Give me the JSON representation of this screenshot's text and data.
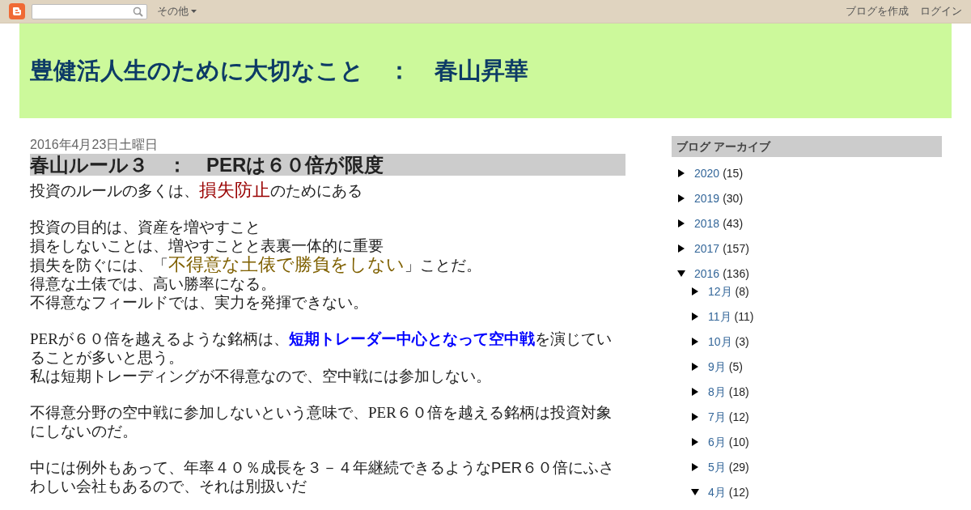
{
  "navbar": {
    "more_menu": "その他",
    "links": [
      "ブログを作成",
      "ログイン"
    ]
  },
  "header": {
    "title": "豊健活人生のために大切なこと　：　春山昇華"
  },
  "post": {
    "date": "2016年4月23日土曜日",
    "title": "春山ルール３　：　PERは６０倍が限度",
    "paragraphs": [
      {
        "kind": "sans",
        "lines": [
          [
            {
              "kind": "plain",
              "text": "投資のルールの多くは、"
            },
            {
              "kind": "red",
              "text": "損失防止"
            },
            {
              "kind": "plain",
              "text": "のためにある"
            }
          ]
        ]
      },
      {
        "kind": "sans",
        "lines": [
          [
            {
              "kind": "plain",
              "text": "投資の目的は、資産を増やすこと"
            }
          ],
          [
            {
              "kind": "plain",
              "text": "損をしないことは、増やすことと表裏一体的に重要"
            }
          ],
          [
            {
              "kind": "plain",
              "text": "損失を防ぐには、「"
            },
            {
              "kind": "olive",
              "text": "不得意な土俵で勝負をしない"
            },
            {
              "kind": "plain",
              "text": "」ことだ。"
            }
          ],
          [
            {
              "kind": "plain",
              "text": "得意な土俵では、高い勝率になる。"
            }
          ],
          [
            {
              "kind": "plain",
              "text": "不得意なフィールドでは、実力を発揮できない。"
            }
          ]
        ]
      },
      {
        "kind": "serif",
        "lines": [
          [
            {
              "kind": "plain",
              "text": "PERが６０倍を越えるような銘柄は、"
            },
            {
              "kind": "link",
              "text": "短期トレーダー中心となって空中戦"
            },
            {
              "kind": "plain",
              "text": "を演じていることが多いと思う。"
            }
          ],
          [
            {
              "kind": "plain",
              "text": "私は短期トレーディングが不得意なので、空中戦には参加しない。"
            }
          ]
        ]
      },
      {
        "kind": "serif",
        "lines": [
          [
            {
              "kind": "plain",
              "text": "不得意分野の空中戦に参加しないという意味で、PER６０倍を越える銘柄は投資対象にしないのだ。"
            }
          ]
        ]
      },
      {
        "kind": "sans",
        "lines": [
          [
            {
              "kind": "plain",
              "text": "中には例外もあって、年率４０％成長を３－４年継続できるようなPER６０倍にふさわしい会社もあるので、それは別扱いだ"
            }
          ]
        ]
      }
    ]
  },
  "sidebar": {
    "title": "ブログ アーカイブ",
    "archive": [
      {
        "label": "2020",
        "count": "(15)",
        "expanded": false
      },
      {
        "label": "2019",
        "count": "(30)",
        "expanded": false
      },
      {
        "label": "2018",
        "count": "(43)",
        "expanded": false
      },
      {
        "label": "2017",
        "count": "(157)",
        "expanded": false
      },
      {
        "label": "2016",
        "count": "(136)",
        "expanded": true,
        "children": [
          {
            "label": "12月",
            "count": "(8)",
            "expanded": false
          },
          {
            "label": "11月",
            "count": "(11)",
            "expanded": false
          },
          {
            "label": "10月",
            "count": "(3)",
            "expanded": false
          },
          {
            "label": "9月",
            "count": "(5)",
            "expanded": false
          },
          {
            "label": "8月",
            "count": "(18)",
            "expanded": false
          },
          {
            "label": "7月",
            "count": "(12)",
            "expanded": false
          },
          {
            "label": "6月",
            "count": "(10)",
            "expanded": false
          },
          {
            "label": "5月",
            "count": "(29)",
            "expanded": false
          },
          {
            "label": "4月",
            "count": "(12)",
            "expanded": true
          }
        ]
      }
    ]
  }
}
